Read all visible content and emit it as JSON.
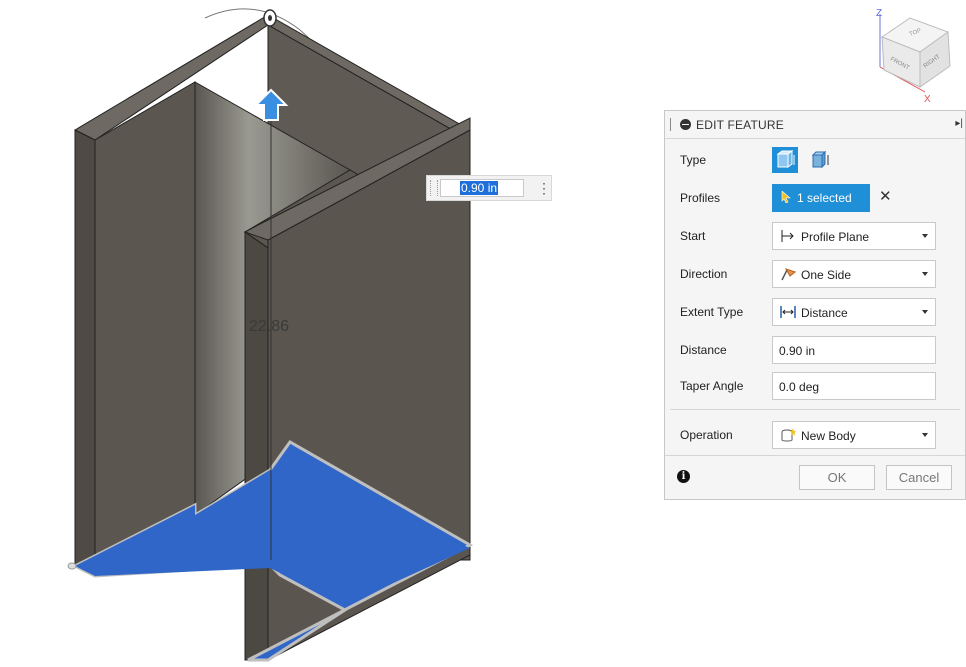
{
  "viewport": {
    "dimension_text": "22.86",
    "inline_distance_value": "0.90 in"
  },
  "viewcube": {
    "axis_z": "Z",
    "axis_x": "X",
    "face_top": "TOP",
    "face_front": "FRONT",
    "face_right": "RIGHT"
  },
  "dialog": {
    "title": "EDIT FEATURE",
    "rows": {
      "type": {
        "label": "Type"
      },
      "profiles": {
        "label": "Profiles",
        "selection": "1 selected"
      },
      "start": {
        "label": "Start",
        "value": "Profile Plane"
      },
      "direction": {
        "label": "Direction",
        "value": "One Side"
      },
      "extent_type": {
        "label": "Extent Type",
        "value": "Distance"
      },
      "distance": {
        "label": "Distance",
        "value": "0.90 in"
      },
      "taper_angle": {
        "label": "Taper Angle",
        "value": "0.0 deg"
      },
      "operation": {
        "label": "Operation",
        "value": "New Body"
      }
    },
    "ok_label": "OK",
    "cancel_label": "Cancel"
  },
  "colors": {
    "body_fill": "#5a554e",
    "profile_blue": "#2f66c8",
    "accent_blue": "#1f8fd8",
    "manipulator_blue": "#3b8fe0"
  }
}
